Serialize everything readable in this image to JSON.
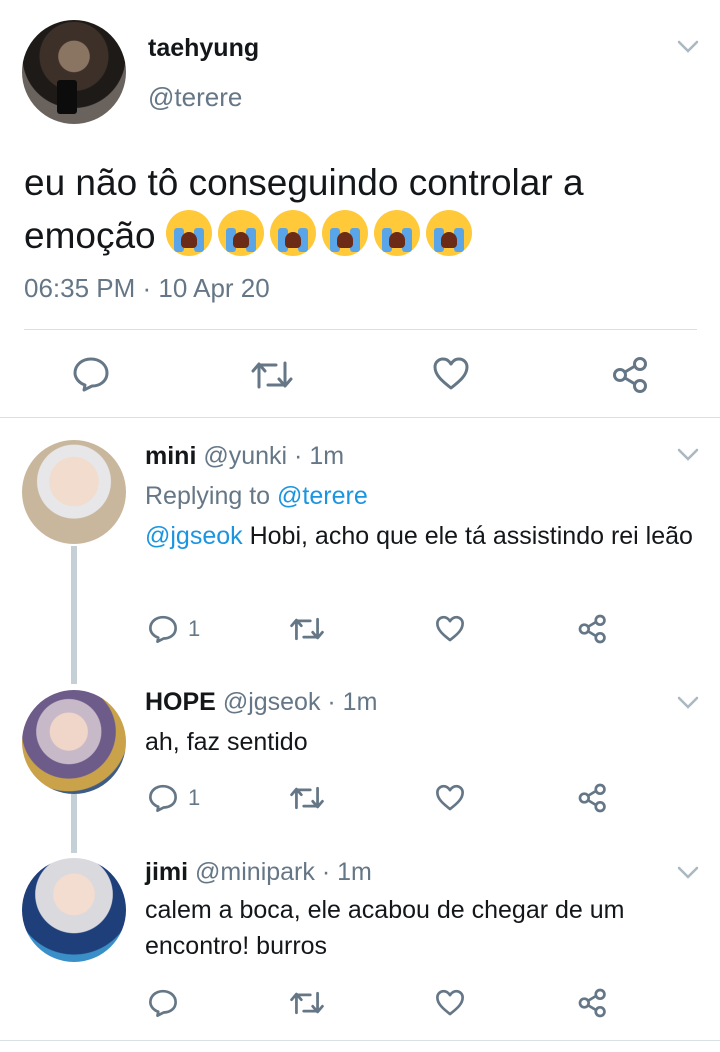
{
  "tweet": {
    "name": "taehyung",
    "handle": "@terere",
    "text": "eu não tô conseguindo controlar a emoção",
    "emoji_name": "loudly-crying-face",
    "emoji_count": 6,
    "timestamp": "06:35 PM · 10 Apr 20"
  },
  "replies": [
    {
      "name": "mini",
      "handle": "@yunki · 1m",
      "replying_prefix": "Replying to ",
      "replying_to": "@terere",
      "mention": "@jgseok",
      "text": " Hobi, acho que ele tá assistindo rei leão",
      "reply_count": "1"
    },
    {
      "name": "HOPE",
      "handle": "@jgseok · 1m",
      "text": "ah, faz sentido",
      "reply_count": "1"
    },
    {
      "name": "jimi",
      "handle": "@minipark · 1m",
      "text": "calem a boca, ele acabou de chegar de um encontro! burros",
      "reply_count": ""
    }
  ],
  "icons": {
    "reply": "reply-icon",
    "retweet": "retweet-icon",
    "like": "heart-icon",
    "share": "share-icon",
    "more": "chevron-down-icon"
  },
  "colors": {
    "text": "#14171a",
    "secondary": "#657786",
    "link": "#1b95e0",
    "divider": "#d9e0e6",
    "thread": "#c4cfd6"
  }
}
